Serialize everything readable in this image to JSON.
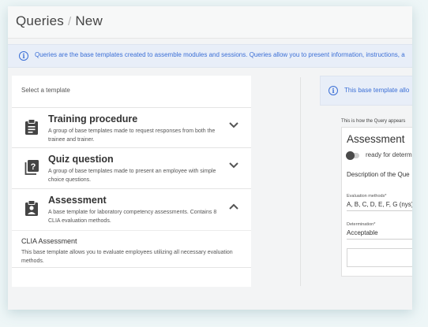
{
  "header": {
    "crumb_root": "Queries",
    "crumb_separator": "/",
    "crumb_current": "New"
  },
  "info_banner": {
    "text": "Queries are the base templates created to assemble modules and sessions. Queries allow you to present information, instructions, a"
  },
  "template_picker": {
    "title": "Select a template",
    "items": [
      {
        "title": "Training procedure",
        "description": "A group of base templates made to request responses from both the trainee and trainer.",
        "icon": "clipboard-icon",
        "expanded": false
      },
      {
        "title": "Quiz question",
        "description": "A group of base templates made to present an employee with simple choice questions.",
        "icon": "question-box-icon",
        "expanded": false
      },
      {
        "title": "Assessment",
        "description": "A base template for laboratory competency assessments. Contains 8 CLIA evaluation methods.",
        "icon": "clipboard-person-icon",
        "expanded": true
      }
    ],
    "sub_item": {
      "title": "CLIA Assessment",
      "description": "This base template allows you to evaluate employees utilizing all necessary evaluation methods."
    }
  },
  "preview": {
    "banner_text": "This base template allo",
    "label": "This is how the Query appears",
    "title": "Assessment",
    "toggle_label": "ready for determ",
    "description": "Description of the Que",
    "eval_label": "Evaluation methods*",
    "eval_value": "A, B, C, D, E, F, G (nys),",
    "determination_label": "Determination*",
    "determination_value": "Acceptable"
  },
  "colors": {
    "accent": "#3b6fd6",
    "banner_bg": "#e8eef8",
    "page_bg": "#f3f4f5"
  }
}
